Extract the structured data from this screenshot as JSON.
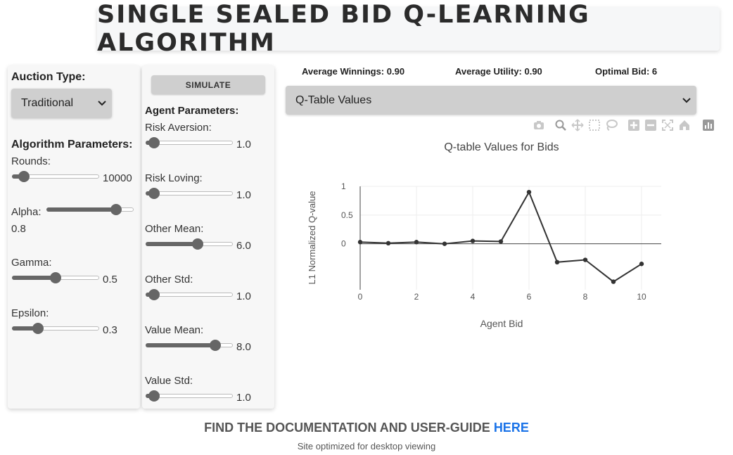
{
  "title": "SINGLE SEALED BID Q-LEARNING ALGORITHM",
  "left_panel": {
    "auction_type_label": "Auction Type:",
    "auction_type_value": "Traditional",
    "algorithm_params_label": "Algorithm Parameters:",
    "rounds_label": "Rounds:",
    "rounds_value": "10000",
    "rounds_fraction": 0.14,
    "alpha_label": "Alpha:",
    "alpha_value": "0.8",
    "alpha_fraction": 0.8,
    "gamma_label": "Gamma:",
    "gamma_value": "0.5",
    "gamma_fraction": 0.5,
    "epsilon_label": "Epsilon:",
    "epsilon_value": "0.3",
    "epsilon_fraction": 0.3
  },
  "mid_panel": {
    "simulate_label": "SIMULATE",
    "agent_params_label": "Agent Parameters:",
    "risk_aversion_label": "Risk Aversion:",
    "risk_aversion_value": "1.0",
    "risk_aversion_fraction": 0.1,
    "risk_loving_label": "Risk Loving:",
    "risk_loving_value": "1.0",
    "risk_loving_fraction": 0.1,
    "other_mean_label": "Other Mean:",
    "other_mean_value": "6.0",
    "other_mean_fraction": 0.6,
    "other_std_label": "Other Std:",
    "other_std_value": "1.0",
    "other_std_fraction": 0.1,
    "value_mean_label": "Value Mean:",
    "value_mean_value": "8.0",
    "value_mean_fraction": 0.8,
    "value_std_label": "Value Std:",
    "value_std_value": "1.0",
    "value_std_fraction": 0.1
  },
  "stats": {
    "avg_winnings": "Average Winnings: 0.90",
    "avg_utility": "Average Utility: 0.90",
    "optimal_bid": "Optimal Bid: 6"
  },
  "view_select": {
    "value": "Q-Table Values"
  },
  "toolbar_icons": [
    "camera-icon",
    "zoom-icon",
    "pan-icon",
    "box-select-icon",
    "lasso-select-icon",
    "zoom-in-icon",
    "zoom-out-icon",
    "autoscale-icon",
    "reset-axes-icon",
    "plotly-logo-icon"
  ],
  "chart_data": {
    "type": "line",
    "title": "Q-table Values for Bids",
    "xlabel": "Agent Bid",
    "ylabel": "L1 Normalized Q-value",
    "x": [
      0,
      1,
      2,
      3,
      4,
      5,
      6,
      7,
      8,
      9,
      10
    ],
    "series": [
      {
        "values": [
          0.03,
          0.01,
          0.03,
          0.0,
          0.05,
          0.04,
          0.9,
          -0.32,
          -0.28,
          -0.66,
          -0.35
        ]
      }
    ],
    "x_ticks": [
      "0",
      "2",
      "4",
      "6",
      "8",
      "10"
    ],
    "y_ticks": [
      "0",
      "0.5",
      "1"
    ],
    "xlim": [
      0,
      10.7
    ],
    "ylim": [
      -0.8,
      1.0
    ],
    "grid": true,
    "line_color": "#333333"
  },
  "footer": {
    "doc_text": "FIND THE DOCUMENTATION AND USER-GUIDE ",
    "doc_link": "HERE",
    "note": "Site optimized for desktop viewing"
  }
}
